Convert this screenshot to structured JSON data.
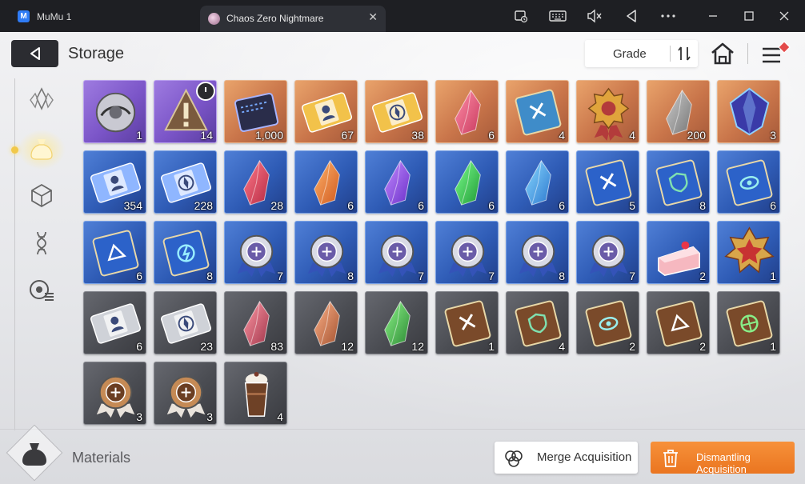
{
  "window": {
    "app_name": "MuMu 1",
    "tab_title": "Chaos Zero Nightmare",
    "tab_close": "✕",
    "controls": [
      "record-icon",
      "keyboard-icon",
      "mute-icon",
      "back-icon",
      "more-icon",
      "minimize-icon",
      "maximize-icon",
      "close-icon"
    ]
  },
  "header": {
    "title": "Storage",
    "sort_label": "Grade"
  },
  "sidebar": {
    "items": [
      "crystal-icon",
      "bag-icon",
      "cube-icon",
      "dna-icon",
      "disc-list-icon"
    ],
    "selected": "bag-icon"
  },
  "items": [
    {
      "name": "silver-orb",
      "rarity": "purple",
      "qty": "1"
    },
    {
      "name": "warning-sign",
      "rarity": "purple",
      "qty": "14",
      "timed": true
    },
    {
      "name": "data-chip",
      "rarity": "orange",
      "qty": "1,000"
    },
    {
      "name": "gold-character-ticket",
      "rarity": "orange",
      "qty": "67"
    },
    {
      "name": "gold-compass-ticket",
      "rarity": "orange",
      "qty": "38"
    },
    {
      "name": "pink-crystal",
      "rarity": "orange",
      "qty": "6"
    },
    {
      "name": "sword-book-gold",
      "rarity": "orange",
      "qty": "4"
    },
    {
      "name": "gold-medal",
      "rarity": "orange",
      "qty": "4"
    },
    {
      "name": "gold-shards",
      "rarity": "orange",
      "qty": "200"
    },
    {
      "name": "blue-gem",
      "rarity": "orange",
      "qty": "3"
    },
    {
      "name": "blue-character-ticket",
      "rarity": "blue",
      "qty": "354"
    },
    {
      "name": "blue-compass-ticket",
      "rarity": "blue",
      "qty": "228"
    },
    {
      "name": "red-shard",
      "rarity": "blue",
      "qty": "28"
    },
    {
      "name": "orange-shard",
      "rarity": "blue",
      "qty": "6"
    },
    {
      "name": "violet-shard",
      "rarity": "blue",
      "qty": "6"
    },
    {
      "name": "green-shard",
      "rarity": "blue",
      "qty": "6"
    },
    {
      "name": "azure-shard",
      "rarity": "blue",
      "qty": "6"
    },
    {
      "name": "sword-book-blue",
      "rarity": "blue",
      "qty": "5"
    },
    {
      "name": "shield-book-blue",
      "rarity": "blue",
      "qty": "8"
    },
    {
      "name": "eye-book-blue",
      "rarity": "blue",
      "qty": "6"
    },
    {
      "name": "arrow-book-blue",
      "rarity": "blue",
      "qty": "6"
    },
    {
      "name": "bolt-book-blue",
      "rarity": "blue",
      "qty": "8"
    },
    {
      "name": "sword-badge",
      "rarity": "blue",
      "qty": "7"
    },
    {
      "name": "shield-badge",
      "rarity": "blue",
      "qty": "8"
    },
    {
      "name": "eye-badge",
      "rarity": "blue",
      "qty": "7"
    },
    {
      "name": "star-badge",
      "rarity": "blue",
      "qty": "7"
    },
    {
      "name": "bolt-badge",
      "rarity": "blue",
      "qty": "8"
    },
    {
      "name": "globe-badge",
      "rarity": "blue",
      "qty": "7"
    },
    {
      "name": "strawberry-cake",
      "rarity": "blue",
      "qty": "2"
    },
    {
      "name": "red-star-medal",
      "rarity": "blue",
      "qty": "1"
    },
    {
      "name": "gray-character-ticket",
      "rarity": "gray",
      "qty": "6"
    },
    {
      "name": "gray-compass-ticket",
      "rarity": "gray",
      "qty": "23"
    },
    {
      "name": "rose-shard",
      "rarity": "gray",
      "qty": "83"
    },
    {
      "name": "amber-shard",
      "rarity": "gray",
      "qty": "12"
    },
    {
      "name": "jade-shard",
      "rarity": "gray",
      "qty": "12"
    },
    {
      "name": "sword-book-brown",
      "rarity": "gray",
      "qty": "1"
    },
    {
      "name": "shield-book-brown",
      "rarity": "gray",
      "qty": "4"
    },
    {
      "name": "eye-book-brown",
      "rarity": "gray",
      "qty": "2"
    },
    {
      "name": "arrow-book-brown",
      "rarity": "gray",
      "qty": "2"
    },
    {
      "name": "globe-book-brown",
      "rarity": "gray",
      "qty": "1"
    },
    {
      "name": "shield-badge-bronze",
      "rarity": "gray",
      "qty": "3"
    },
    {
      "name": "bolt-badge-bronze",
      "rarity": "gray",
      "qty": "3"
    },
    {
      "name": "chocolate-frappe",
      "rarity": "gray",
      "qty": "4"
    }
  ],
  "footer": {
    "category_label": "Materials",
    "merge_label": "Merge Acquisition",
    "dismantle_label": "Dismantling Acquisition"
  },
  "colors": {
    "accent_orange": "#ea7520",
    "rarity_purple": "#7b55c8",
    "rarity_orange": "#c9754a",
    "rarity_blue": "#2f5cb6",
    "rarity_gray": "#4b4d53"
  }
}
